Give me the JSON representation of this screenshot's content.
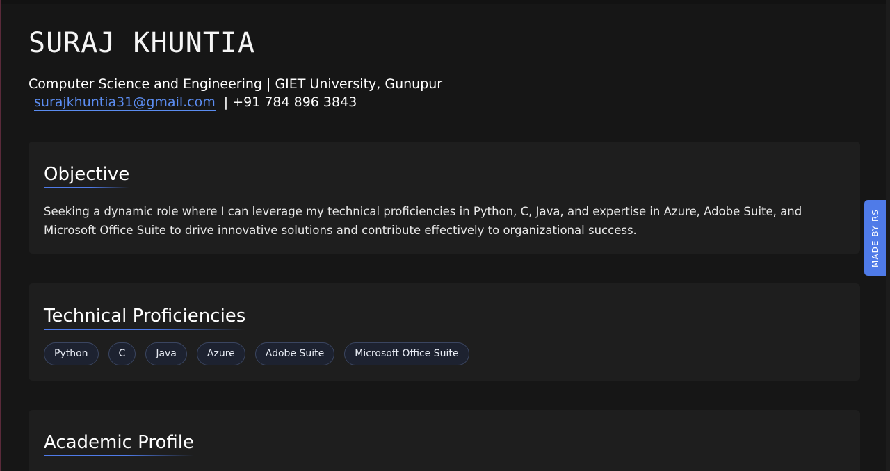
{
  "header": {
    "name": "SURAJ KHUNTIA",
    "subtitle": "Computer Science and Engineering | GIET University, Gunupur",
    "email": "surajkhuntia31@gmail.com",
    "phone": "| +91 784 896 3843"
  },
  "objective": {
    "title": "Objective",
    "text": "Seeking a dynamic role where I can leverage my technical proficiencies in Python, C, Java, and expertise in Azure, Adobe Suite, and Microsoft Office Suite to drive innovative solutions and contribute effectively to organizational success."
  },
  "technical": {
    "title": "Technical Proficiencies",
    "skills": [
      "Python",
      "C",
      "Java",
      "Azure",
      "Adobe Suite",
      "Microsoft Office Suite"
    ]
  },
  "academic": {
    "title": "Academic Profile"
  },
  "side_tab": {
    "label": "MADE BY RS"
  },
  "colors": {
    "accent": "#4f7be8",
    "link": "#5b8cf0",
    "background": "#161616",
    "card": "#1e1e1e"
  }
}
